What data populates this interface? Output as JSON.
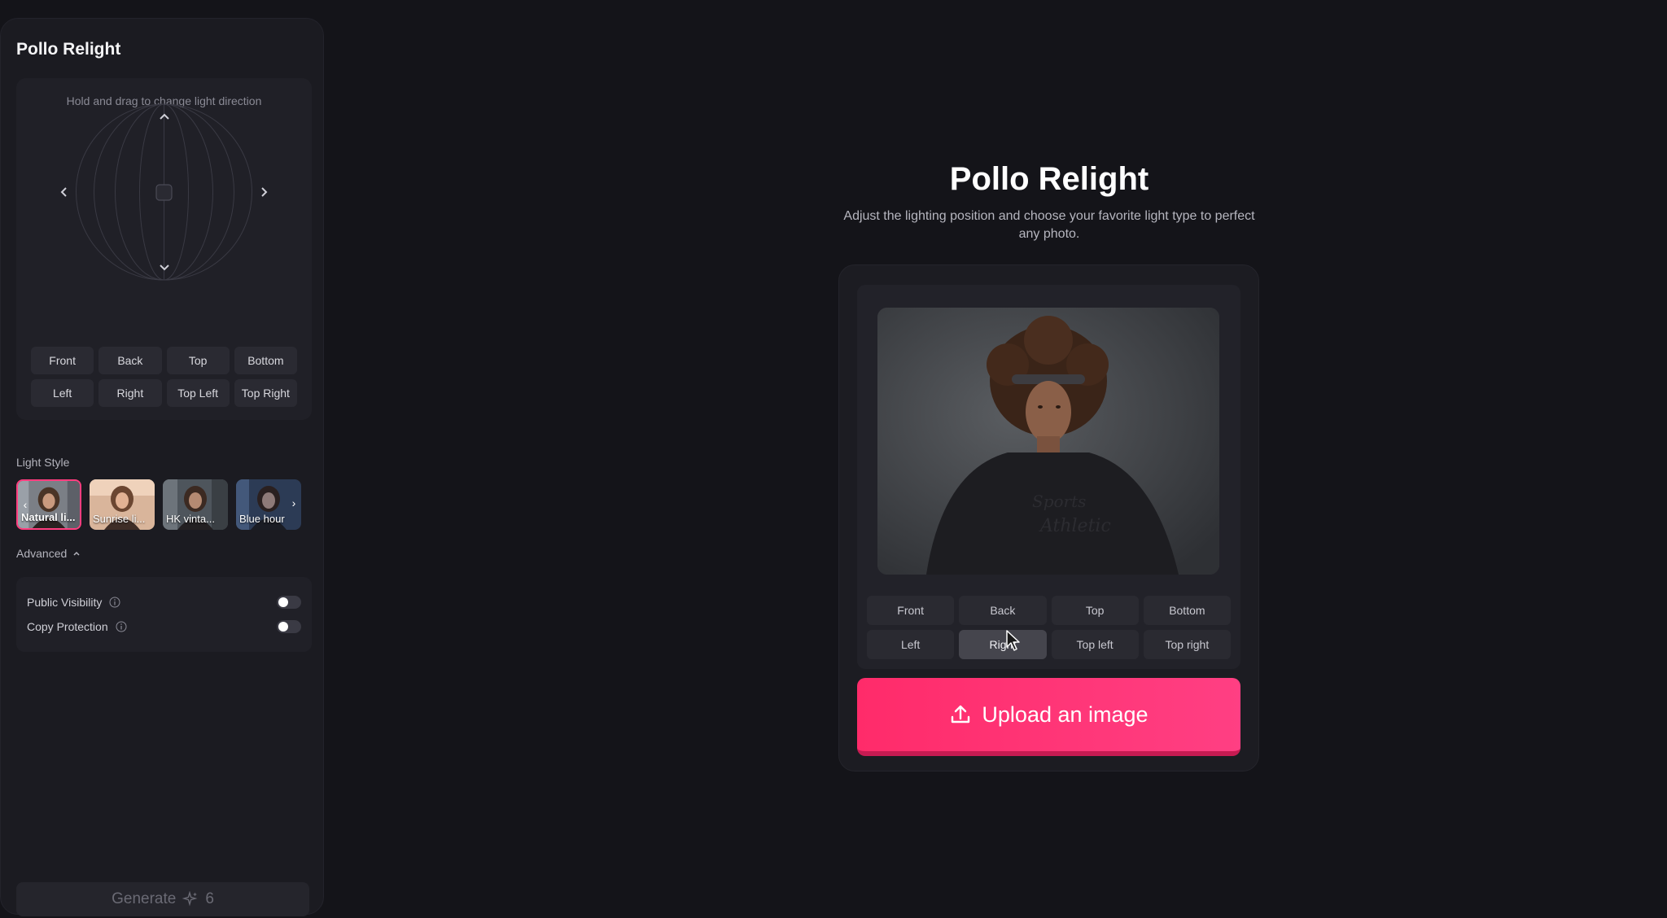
{
  "sidebar": {
    "title": "Pollo Relight",
    "direction_hint": "Hold and drag to change light direction",
    "direction_buttons": [
      "Front",
      "Back",
      "Top",
      "Bottom",
      "Left",
      "Right",
      "Top Left",
      "Top Right"
    ],
    "light_style_label": "Light Style",
    "styles": [
      {
        "label": "Natural li...",
        "active": true
      },
      {
        "label": "Sunrise li..."
      },
      {
        "label": "HK vinta..."
      },
      {
        "label": "Blue hour"
      }
    ],
    "advanced_label": "Advanced",
    "public_visibility_label": "Public Visibility",
    "copy_protection_label": "Copy Protection",
    "generate_label": "Generate",
    "generate_cost": "6"
  },
  "main": {
    "title": "Pollo Relight",
    "subtitle": "Adjust the lighting position and choose your favorite light type to perfect any photo.",
    "position_buttons": [
      "Front",
      "Back",
      "Top",
      "Bottom",
      "Left",
      "Right",
      "Top left",
      "Top right"
    ],
    "upload_label": "Upload an image"
  },
  "colors": {
    "accent": "#ff3d7f",
    "background": "#141419",
    "panel": "#1b1b21"
  }
}
